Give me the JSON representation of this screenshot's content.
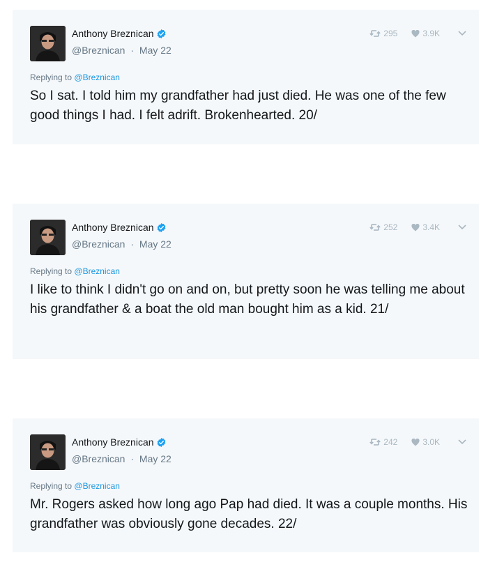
{
  "tweets": [
    {
      "name": "Anthony Breznican",
      "handle": "@Breznican",
      "date": "May 22",
      "retweets": "295",
      "likes": "3.9K",
      "replying_label": "Replying to",
      "replying_handle": "@Breznican",
      "text": "So I sat. I told him my grandfather had just died. He was one of the few good things I had. I felt adrift. Brokenhearted. 20/"
    },
    {
      "name": "Anthony Breznican",
      "handle": "@Breznican",
      "date": "May 22",
      "retweets": "252",
      "likes": "3.4K",
      "replying_label": "Replying to",
      "replying_handle": "@Breznican",
      "text": "I like to think I didn't go on and on, but pretty soon he was telling me about his grandfather & a boat the old man bought him as a kid. 21/"
    },
    {
      "name": "Anthony Breznican",
      "handle": "@Breznican",
      "date": "May 22",
      "retweets": "242",
      "likes": "3.0K",
      "replying_label": "Replying to",
      "replying_handle": "@Breznican",
      "text": "Mr. Rogers asked how long ago Pap had died. It was a couple months. His grandfather was obviously gone decades. 22/"
    }
  ],
  "separator": "·",
  "icons": {
    "avatar": "avatar-photo",
    "verified": "verified-badge-icon",
    "retweet": "retweet-icon",
    "like": "heart-icon",
    "menu": "chevron-down-icon"
  },
  "colors": {
    "card_background": "#f5f8fa",
    "verified_blue": "#1da1f2",
    "link_blue": "#1b95e0",
    "muted_text": "#657786",
    "stat_gray": "#aab8c2"
  }
}
